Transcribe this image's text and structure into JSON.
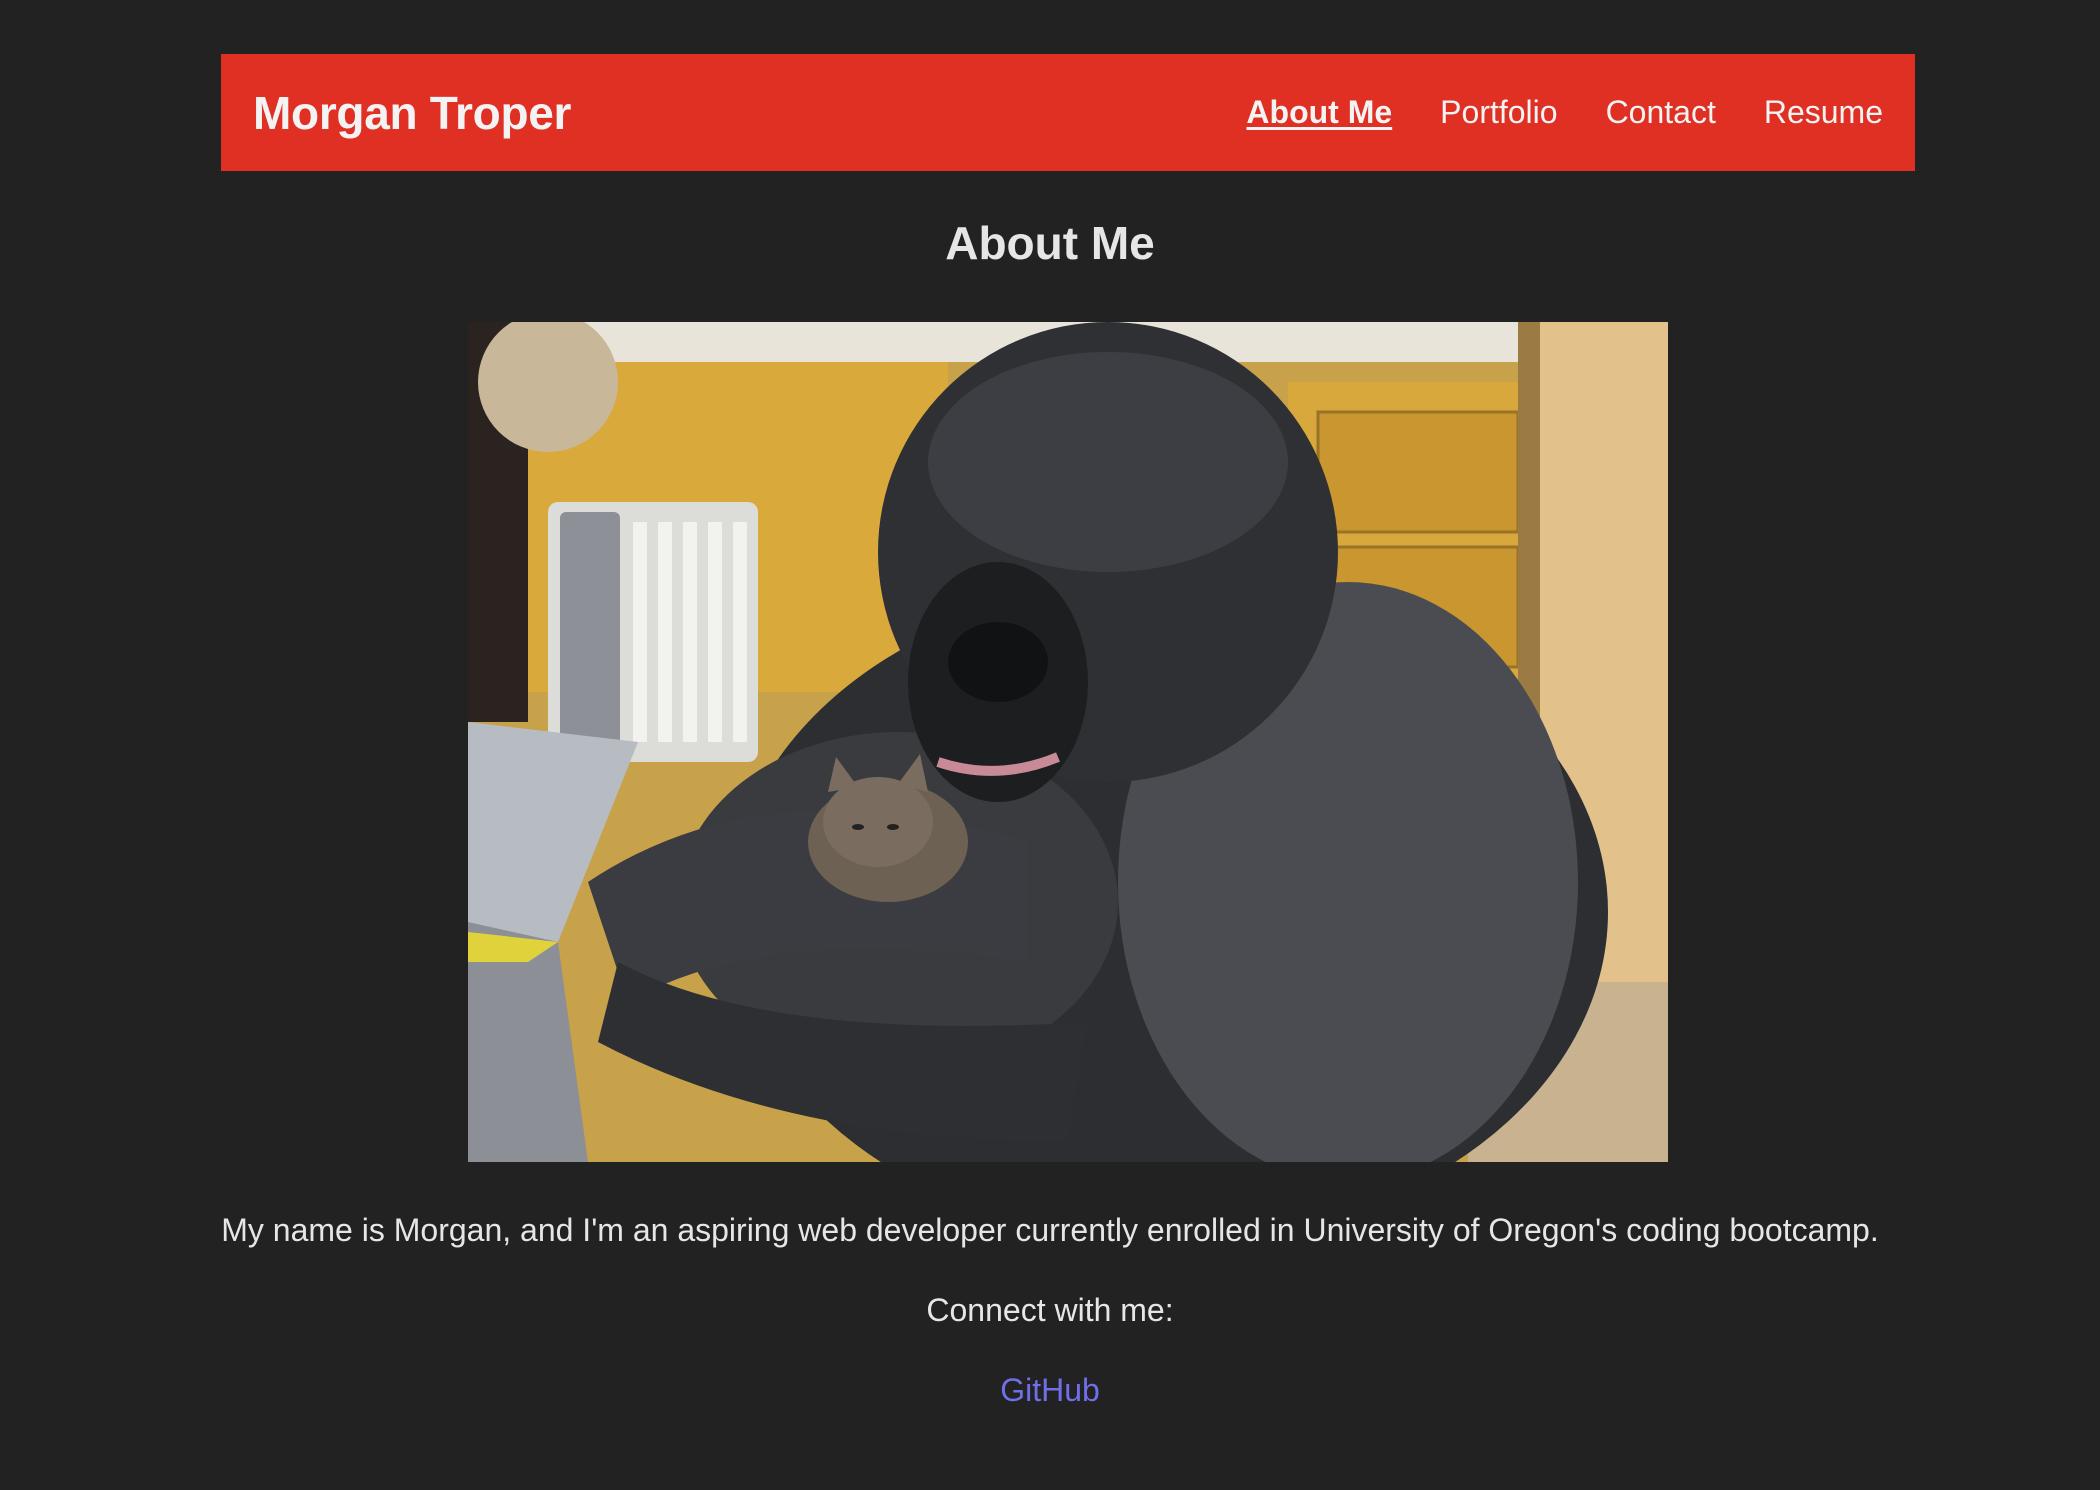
{
  "header": {
    "brand": "Morgan Troper",
    "nav": [
      {
        "label": "About Me",
        "active": true
      },
      {
        "label": "Portfolio",
        "active": false
      },
      {
        "label": "Contact",
        "active": false
      },
      {
        "label": "Resume",
        "active": false
      }
    ]
  },
  "main": {
    "title": "About Me",
    "photo": {
      "subject": "gorilla-holding-kitten-photo"
    },
    "bio": "My name is Morgan, and I'm an aspiring web developer currently enrolled in University of Oregon's coding bootcamp.",
    "connect_label": "Connect with me:",
    "links": [
      {
        "label": "GitHub"
      }
    ]
  },
  "colors": {
    "background": "#222222",
    "navbar": "#e03024",
    "text": "#e6e6e6",
    "link": "#6f6fe8"
  }
}
